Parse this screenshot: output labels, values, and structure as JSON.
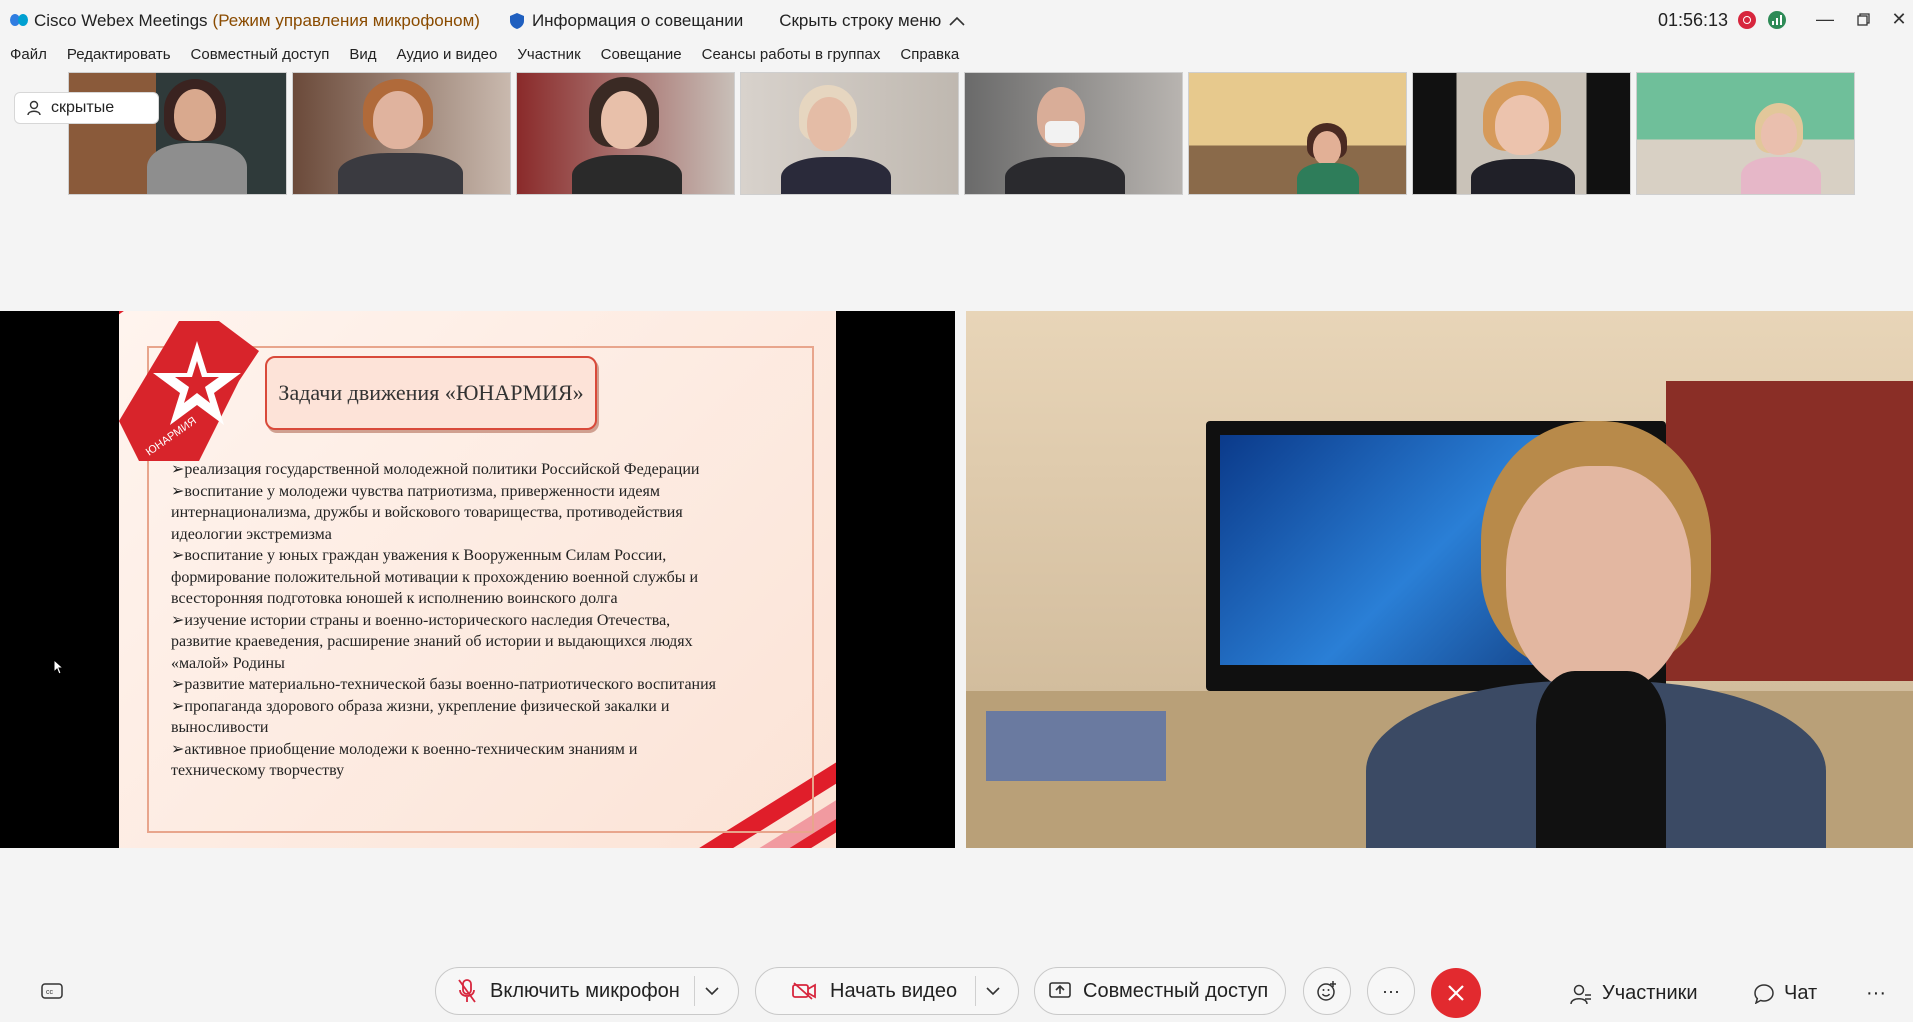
{
  "titlebar": {
    "app_title": "Cisco Webex Meetings",
    "mode": "(Режим управления микрофоном)",
    "meeting_info": "Информация о совещании",
    "hide_menu": "Скрыть строку меню",
    "timer": "01:56:13"
  },
  "menu": [
    "Файл",
    "Редактировать",
    "Совместный доступ",
    "Вид",
    "Аудио и видео",
    "Участник",
    "Совещание",
    "Сеансы работы в группах",
    "Справка"
  ],
  "hidden_label": "скрытые",
  "slide": {
    "logo_text": "ЮНАРМИЯ",
    "title": "Задачи движения «ЮНАРМИЯ»",
    "lines": [
      "➢реализация государственной молодежной политики Российской Федерации",
      "➢воспитание у молодежи чувства патриотизма, приверженности идеям",
      "интернационализма, дружбы и войскового товарищества, противодействия",
      "идеологии экстремизма",
      "➢воспитание у юных граждан уважения к Вооруженным Силам России,",
      "формирование положительной мотивации к прохождению военной службы и",
      "всесторонняя подготовка юношей к исполнению воинского долга",
      "➢изучение истории страны и военно-исторического наследия Отечества,",
      "развитие краеведения, расширение знаний об истории и выдающихся людях",
      "«малой» Родины",
      "➢развитие материально-технической базы военно-патриотического воспитания",
      "➢пропаганда здорового образа жизни, укрепление физической закалки и",
      "выносливости",
      "➢активное приобщение молодежи к военно-техническим знаниям и",
      "техническому творчеству"
    ]
  },
  "controls": {
    "mic": "Включить микрофон",
    "video": "Начать видео",
    "share": "Совместный доступ",
    "more": "···",
    "participants": "Участники",
    "chat": "Чат",
    "overflow": "···"
  },
  "colors": {
    "end_call": "#e22a2f",
    "record": "#d7263d",
    "mode_text": "#8a4b00"
  }
}
